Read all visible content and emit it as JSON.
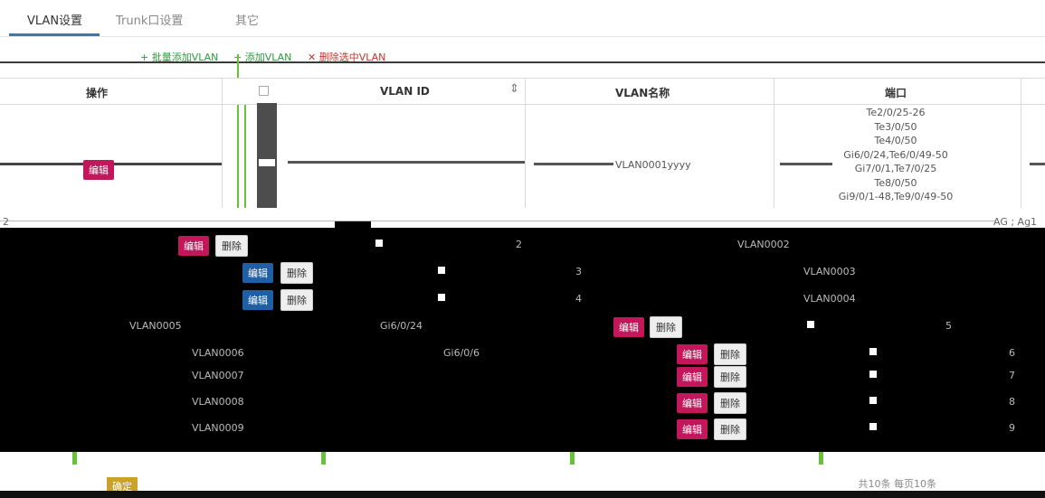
{
  "tabs": [
    {
      "label": "VLAN设置"
    },
    {
      "label": "Trunk口设置"
    },
    {
      "label": "其它"
    }
  ],
  "toolbar": {
    "batch_add": "批量添加VLAN",
    "add": "添加VLAN",
    "delete_selected": "删除选中VLAN"
  },
  "table": {
    "headers": {
      "ops": "操作",
      "vlan_id": "VLAN ID",
      "vlan_name": "VLAN名称",
      "ports": "端口"
    },
    "row1": {
      "edit": "编辑",
      "name": "VLAN0001yyyy",
      "ports": [
        "Te2/0/25-26",
        "Te3/0/50",
        "Te4/0/50",
        "Gi6/0/24,Te6/0/49-50",
        "Gi7/0/1,Te7/0/25",
        "Te8/0/50",
        "Gi9/0/1-48,Te9/0/49-50"
      ],
      "suffix": "AG ; Ag1"
    }
  },
  "rows": [
    {
      "edit": "编辑",
      "del": "删除",
      "id": "2",
      "name": "VLAN0002"
    },
    {
      "edit": "编辑",
      "del": "删除",
      "id": "3",
      "name": "VLAN0003"
    },
    {
      "edit": "编辑",
      "del": "删除",
      "id": "4",
      "name": "VLAN0004"
    },
    {
      "edit": "编辑",
      "del": "删除",
      "id": "5",
      "name": "VLAN0005",
      "ports": "Gi6/0/24"
    },
    {
      "edit": "编辑",
      "del": "删除",
      "id": "6",
      "name": "VLAN0006",
      "ports": "Gi6/0/6"
    },
    {
      "edit": "编辑",
      "del": "删除",
      "id": "7",
      "name": "VLAN0007"
    },
    {
      "edit": "编辑",
      "del": "删除",
      "id": "8",
      "name": "VLAN0008"
    },
    {
      "edit": "编辑",
      "del": "删除",
      "id": "9",
      "name": "VLAN0009"
    }
  ],
  "footer": {
    "confirm": "确定",
    "pager": "共10条 每页10条"
  },
  "colors": {
    "edit_red": "#c2185b",
    "edit_blue": "#1f5fa6",
    "accent_green": "#67c23a"
  }
}
